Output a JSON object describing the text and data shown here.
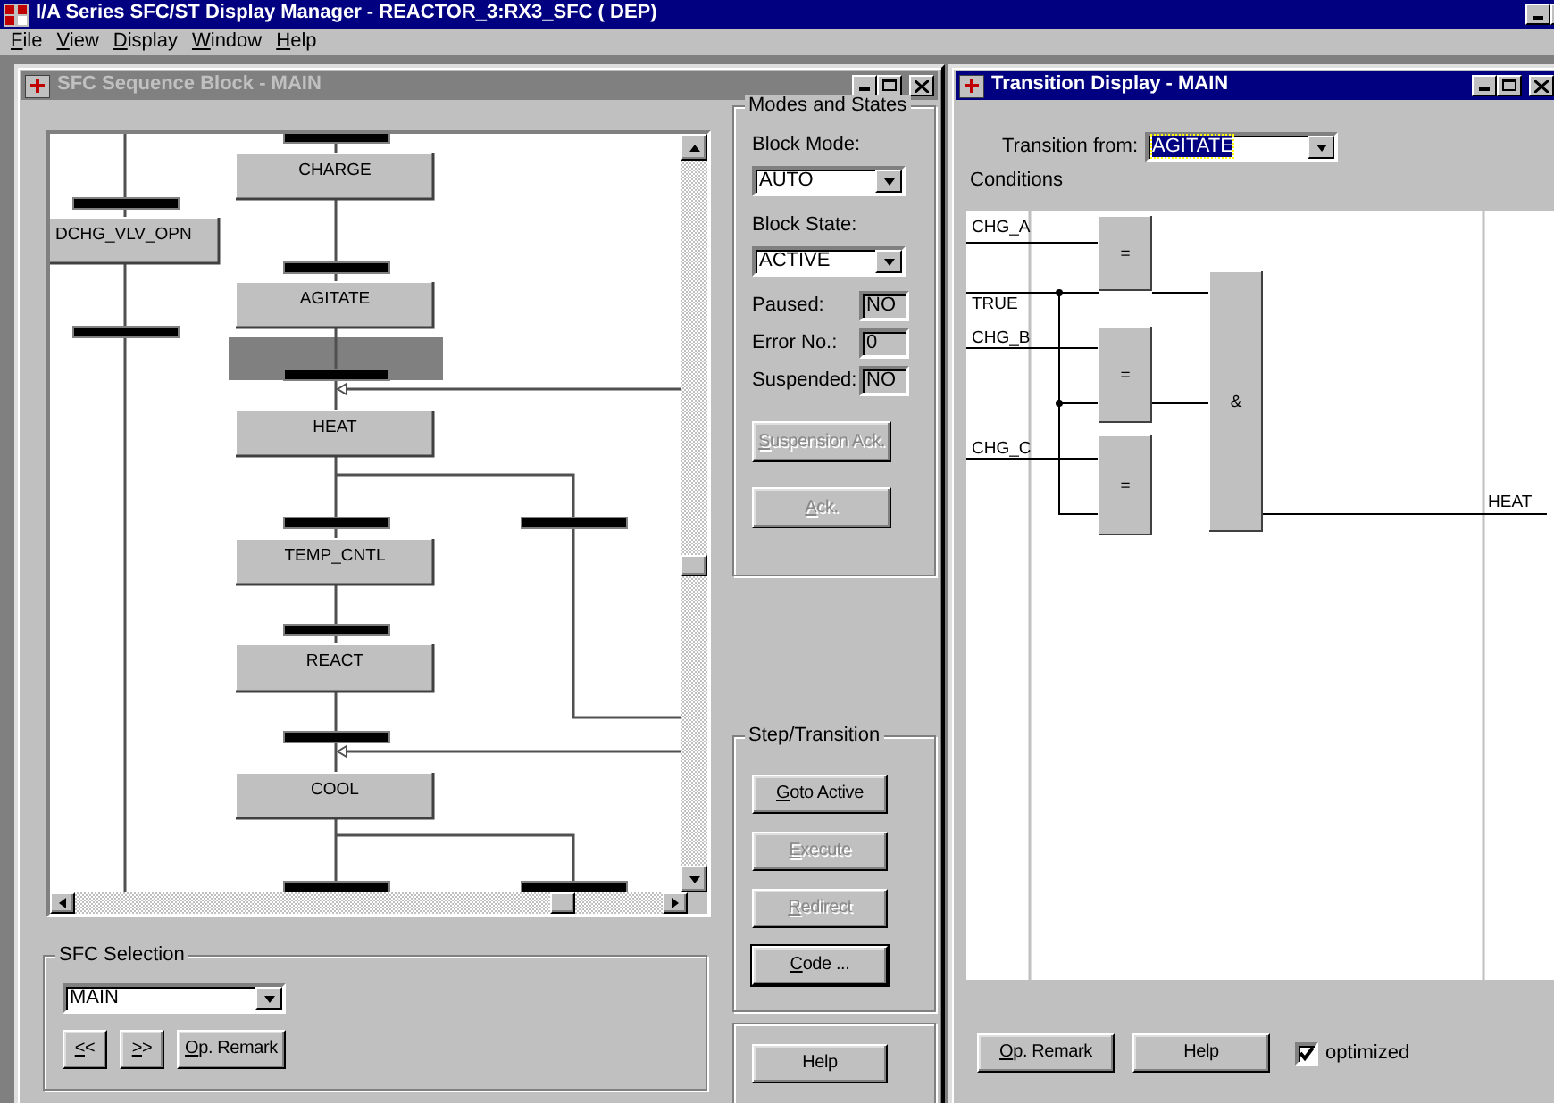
{
  "app": {
    "title": "I/A Series SFC/ST Display Manager - REACTOR_3:RX3_SFC ( DEP)"
  },
  "menu": [
    {
      "label": "File",
      "mnemonic": true
    },
    {
      "label": "View",
      "mnemonic": true
    },
    {
      "label": "Display",
      "mnemonic": true
    },
    {
      "label": "Window",
      "mnemonic": true
    },
    {
      "label": "Help",
      "mnemonic": true
    }
  ],
  "sequence_window": {
    "title": "SFC Sequence Block - MAIN",
    "active": false,
    "steps": [
      {
        "label": "CHARGE"
      },
      {
        "label": "DCHG_VLV_OPN"
      },
      {
        "label": "AGITATE"
      },
      {
        "label": "HEAT"
      },
      {
        "label": "TEMP_CNTL"
      },
      {
        "label": "REACT"
      },
      {
        "label": "COOL"
      }
    ],
    "transitions": [
      {
        "selected": false
      },
      {
        "selected": false
      },
      {
        "selected": false
      },
      {
        "selected": false
      },
      {
        "selected": true
      },
      {
        "selected": false
      },
      {
        "selected": false
      },
      {
        "selected": false
      },
      {
        "selected": false
      },
      {
        "selected": false
      },
      {
        "selected": false
      }
    ],
    "modes_and_states": {
      "title": "Modes and States",
      "block_mode": {
        "label": "Block Mode:",
        "value": "AUTO"
      },
      "block_state": {
        "label": "Block State:",
        "value": "ACTIVE"
      },
      "status_fields": [
        {
          "label": "Paused:",
          "value": "NO"
        },
        {
          "label": "Error No.:",
          "value": "0"
        },
        {
          "label": "Suspended:",
          "value": "NO"
        }
      ],
      "buttons": [
        {
          "label": "Suspension Ack.",
          "mnemonic": true,
          "disabled": true,
          "default": false
        },
        {
          "label": "Ack.",
          "mnemonic": true,
          "disabled": true,
          "default": false
        }
      ]
    },
    "step_transition": {
      "title": "Step/Transition",
      "buttons": [
        {
          "label": "Goto Active",
          "mnemonic": true,
          "disabled": false,
          "default": false
        },
        {
          "label": "Execute",
          "mnemonic": true,
          "disabled": true,
          "default": false
        },
        {
          "label": "Redirect",
          "mnemonic": true,
          "disabled": true,
          "default": false
        },
        {
          "label": "Code ...",
          "mnemonic": true,
          "disabled": false,
          "default": true
        }
      ]
    },
    "help_button": {
      "label": "Help",
      "mnemonic": false
    },
    "sfc_selection": {
      "title": "SFC Selection",
      "value": "MAIN",
      "buttons": [
        {
          "label": "<<",
          "mnemonic": true
        },
        {
          "label": ">>",
          "mnemonic": true
        },
        {
          "label": "Op. Remark",
          "mnemonic": true
        }
      ]
    }
  },
  "transition_window": {
    "title": "Transition Display - MAIN",
    "active": true,
    "transition_from": {
      "label": "Transition from:",
      "value": "AGITATE",
      "focused": true
    },
    "conditions_label": "Conditions",
    "inputs": [
      "CHG_A",
      "TRUE",
      "CHG_B",
      "CHG_C"
    ],
    "gates": [
      {
        "symbol": "="
      },
      {
        "symbol": "="
      },
      {
        "symbol": "="
      },
      {
        "symbol": "&"
      }
    ],
    "output": "HEAT",
    "buttons": [
      {
        "label": "Op. Remark",
        "mnemonic": true
      },
      {
        "label": "Help",
        "mnemonic": false
      }
    ],
    "optimized": {
      "label": "optimized",
      "checked": true
    }
  }
}
